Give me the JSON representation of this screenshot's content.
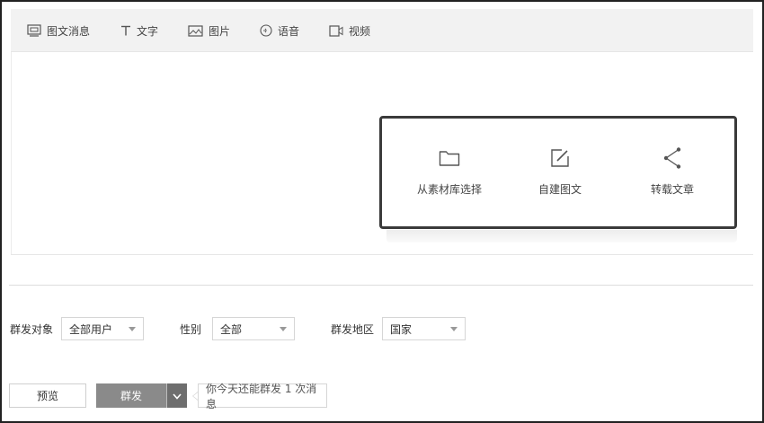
{
  "tabs": [
    {
      "label": "图文消息",
      "icon": "news-icon"
    },
    {
      "label": "文字",
      "icon": "text-icon"
    },
    {
      "label": "图片",
      "icon": "image-icon"
    },
    {
      "label": "语音",
      "icon": "voice-icon"
    },
    {
      "label": "视频",
      "icon": "video-icon"
    }
  ],
  "create_options": [
    {
      "label": "从素材库选择",
      "icon": "folder-icon"
    },
    {
      "label": "自建图文",
      "icon": "edit-icon"
    },
    {
      "label": "转载文章",
      "icon": "share-icon"
    }
  ],
  "filters": {
    "target_label": "群发对象",
    "target_value": "全部用户",
    "gender_label": "性别",
    "gender_value": "全部",
    "region_label": "群发地区",
    "region_value": "国家"
  },
  "actions": {
    "preview_label": "预览",
    "send_label": "群发",
    "hint_text": "你今天还能群发 1 次消息"
  }
}
